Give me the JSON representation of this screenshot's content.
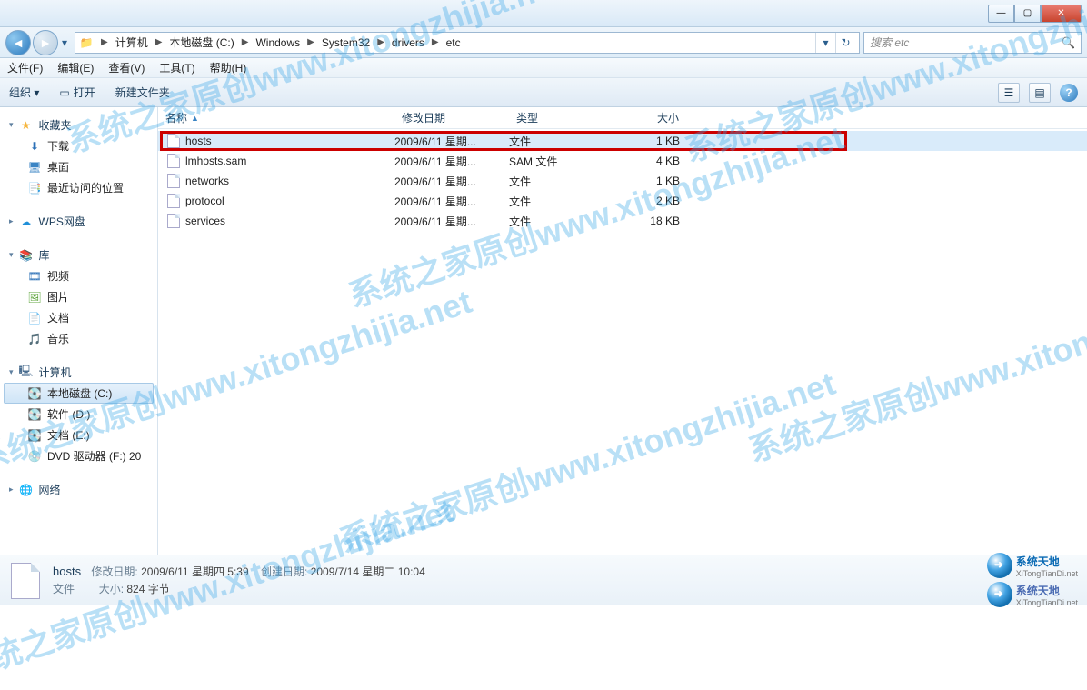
{
  "titlebar": {
    "min": "—",
    "max": "▢",
    "close": "✕"
  },
  "nav": {
    "back": "◄",
    "fwd": "►",
    "drop": "▾",
    "path": [
      "计算机",
      "本地磁盘 (C:)",
      "Windows",
      "System32",
      "drivers",
      "etc"
    ],
    "refresh": "↻",
    "history": "▾"
  },
  "search": {
    "placeholder": "搜索 etc",
    "icon": "🔍"
  },
  "menu": {
    "file": "文件(F)",
    "edit": "编辑(E)",
    "view": "查看(V)",
    "tools": "工具(T)",
    "help": "帮助(H)"
  },
  "toolbar": {
    "organize": "组织 ▾",
    "open": "打开",
    "newfolder": "新建文件夹",
    "views": "☰",
    "preview": "▤",
    "help": "?"
  },
  "sidebar": {
    "favorites": {
      "label": "收藏夹",
      "items": [
        {
          "label": "下载"
        },
        {
          "label": "桌面"
        },
        {
          "label": "最近访问的位置"
        }
      ]
    },
    "wps": {
      "label": "WPS网盘"
    },
    "libraries": {
      "label": "库",
      "items": [
        {
          "label": "视频"
        },
        {
          "label": "图片"
        },
        {
          "label": "文档"
        },
        {
          "label": "音乐"
        }
      ]
    },
    "computer": {
      "label": "计算机",
      "items": [
        {
          "label": "本地磁盘 (C:)"
        },
        {
          "label": "软件 (D:)"
        },
        {
          "label": "文档 (E:)"
        },
        {
          "label": "DVD 驱动器 (F:) 20"
        }
      ]
    },
    "network": {
      "label": "网络"
    }
  },
  "columns": {
    "name": "名称",
    "date": "修改日期",
    "type": "类型",
    "size": "大小"
  },
  "files": [
    {
      "name": "hosts",
      "date": "2009/6/11 星期...",
      "type": "文件",
      "size": "1 KB",
      "selected": true,
      "highlight": true
    },
    {
      "name": "lmhosts.sam",
      "date": "2009/6/11 星期...",
      "type": "SAM 文件",
      "size": "4 KB"
    },
    {
      "name": "networks",
      "date": "2009/6/11 星期...",
      "type": "文件",
      "size": "1 KB"
    },
    {
      "name": "protocol",
      "date": "2009/6/11 星期...",
      "type": "文件",
      "size": "2 KB"
    },
    {
      "name": "services",
      "date": "2009/6/11 星期...",
      "type": "文件",
      "size": "18 KB"
    }
  ],
  "details": {
    "name": "hosts",
    "mod_label": "修改日期:",
    "mod": "2009/6/11 星期四 5:39",
    "create_label": "创建日期:",
    "create": "2009/7/14 星期二 10:04",
    "type": "文件",
    "size_label": "大小:",
    "size": "824 字节"
  },
  "logos": {
    "a": {
      "main": "系统天地",
      "sub": "XiTongTianDi.net"
    },
    "b": {
      "main": "系统天地",
      "sub": "XiTongTianDi.net"
    }
  },
  "watermark": "系统之家原创www.xitongzhijia.net"
}
